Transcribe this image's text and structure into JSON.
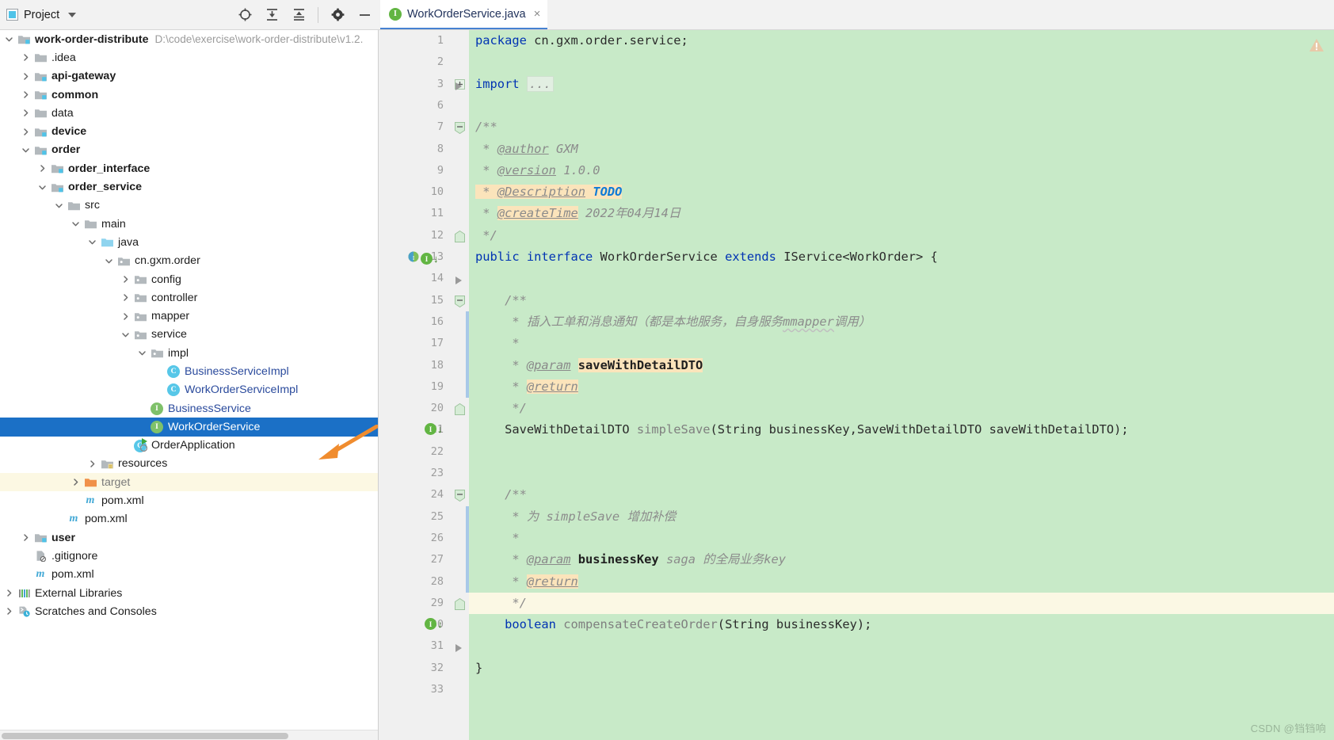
{
  "window": {
    "project_panel_title": "Project",
    "editor_tab": {
      "label": "WorkOrderService.java",
      "badge": "I",
      "close": "×"
    },
    "toolbar_icons": [
      "locate-icon",
      "expand-all-icon",
      "collapse-all-icon",
      "gear-icon",
      "minimize-icon"
    ]
  },
  "tree": [
    {
      "depth": 0,
      "arrow": "down",
      "icon": "module-folder",
      "label": "work-order-distribute",
      "bold": true,
      "path": "D:\\code\\exercise\\work-order-distribute\\v1.2."
    },
    {
      "depth": 1,
      "arrow": "right",
      "icon": "folder",
      "label": ".idea",
      "bold": false
    },
    {
      "depth": 1,
      "arrow": "right",
      "icon": "module-folder",
      "label": "api-gateway",
      "bold": true
    },
    {
      "depth": 1,
      "arrow": "right",
      "icon": "module-folder",
      "label": "common",
      "bold": true
    },
    {
      "depth": 1,
      "arrow": "right",
      "icon": "folder",
      "label": "data",
      "bold": false
    },
    {
      "depth": 1,
      "arrow": "right",
      "icon": "module-folder",
      "label": "device",
      "bold": true
    },
    {
      "depth": 1,
      "arrow": "down",
      "icon": "module-folder",
      "label": "order",
      "bold": true
    },
    {
      "depth": 2,
      "arrow": "right",
      "icon": "module-folder",
      "label": "order_interface",
      "bold": true
    },
    {
      "depth": 2,
      "arrow": "down",
      "icon": "module-folder",
      "label": "order_service",
      "bold": true
    },
    {
      "depth": 3,
      "arrow": "down",
      "icon": "folder",
      "label": "src",
      "bold": false
    },
    {
      "depth": 4,
      "arrow": "down",
      "icon": "folder",
      "label": "main",
      "bold": false
    },
    {
      "depth": 5,
      "arrow": "down",
      "icon": "source-folder",
      "label": "java",
      "bold": false
    },
    {
      "depth": 6,
      "arrow": "down",
      "icon": "package",
      "label": "cn.gxm.order",
      "bold": false
    },
    {
      "depth": 7,
      "arrow": "right",
      "icon": "package",
      "label": "config",
      "bold": false
    },
    {
      "depth": 7,
      "arrow": "right",
      "icon": "package",
      "label": "controller",
      "bold": false
    },
    {
      "depth": 7,
      "arrow": "right",
      "icon": "package",
      "label": "mapper",
      "bold": false
    },
    {
      "depth": 7,
      "arrow": "down",
      "icon": "package",
      "label": "service",
      "bold": false
    },
    {
      "depth": 8,
      "arrow": "down",
      "icon": "package",
      "label": "impl",
      "bold": false
    },
    {
      "depth": 9,
      "arrow": "none",
      "icon": "class",
      "label": "BusinessServiceImpl",
      "bold": false,
      "link": true
    },
    {
      "depth": 9,
      "arrow": "none",
      "icon": "class",
      "label": "WorkOrderServiceImpl",
      "bold": false,
      "link": true
    },
    {
      "depth": 8,
      "arrow": "none",
      "icon": "interface",
      "label": "BusinessService",
      "bold": false,
      "link": true
    },
    {
      "depth": 8,
      "arrow": "none",
      "icon": "interface",
      "label": "WorkOrderService",
      "bold": false,
      "link": true,
      "selected": true
    },
    {
      "depth": 7,
      "arrow": "none",
      "icon": "runnable-class",
      "label": "OrderApplication",
      "bold": false
    },
    {
      "depth": 5,
      "arrow": "right",
      "icon": "resources-folder",
      "label": "resources",
      "bold": false
    },
    {
      "depth": 4,
      "arrow": "right",
      "icon": "target-folder",
      "label": "target",
      "bold": false,
      "highlight": true,
      "muted": true
    },
    {
      "depth": 4,
      "arrow": "none",
      "icon": "maven",
      "label": "pom.xml",
      "bold": false
    },
    {
      "depth": 3,
      "arrow": "none",
      "icon": "maven",
      "label": "pom.xml",
      "bold": false
    },
    {
      "depth": 1,
      "arrow": "right",
      "icon": "module-folder",
      "label": "user",
      "bold": true
    },
    {
      "depth": 1,
      "arrow": "none",
      "icon": "gitignore",
      "label": ".gitignore",
      "bold": false
    },
    {
      "depth": 1,
      "arrow": "none",
      "icon": "maven",
      "label": "pom.xml",
      "bold": false
    },
    {
      "depth": 0,
      "arrow": "right",
      "icon": "external-libraries",
      "label": "External Libraries",
      "bold": false
    },
    {
      "depth": 0,
      "arrow": "right",
      "icon": "scratches",
      "label": "Scratches and Consoles",
      "bold": false
    }
  ],
  "code": {
    "line_numbers": [
      1,
      2,
      3,
      6,
      7,
      8,
      9,
      10,
      11,
      12,
      13,
      14,
      15,
      16,
      17,
      18,
      19,
      20,
      21,
      22,
      23,
      24,
      25,
      26,
      27,
      28,
      29,
      30,
      31,
      32,
      33
    ],
    "lines": [
      {
        "n": 1,
        "segments": [
          {
            "t": "package ",
            "c": "kw"
          },
          {
            "t": "cn.gxm.order.service;",
            "c": ""
          }
        ]
      },
      {
        "n": 2,
        "segments": []
      },
      {
        "n": 3,
        "segments": [
          {
            "t": "import ",
            "c": "kw"
          },
          {
            "t": "...",
            "c": "fold-placeholder"
          }
        ]
      },
      {
        "n": 6,
        "segments": []
      },
      {
        "n": 7,
        "segments": [
          {
            "t": "/**",
            "c": "cmt"
          }
        ]
      },
      {
        "n": 8,
        "segments": [
          {
            "t": " * ",
            "c": "cmt"
          },
          {
            "t": "@author",
            "c": "tag"
          },
          {
            "t": " GXM",
            "c": "cmt"
          }
        ]
      },
      {
        "n": 9,
        "segments": [
          {
            "t": " * ",
            "c": "cmt"
          },
          {
            "t": "@version",
            "c": "tag"
          },
          {
            "t": " 1.0.0",
            "c": "cmt"
          }
        ]
      },
      {
        "n": 10,
        "segments": [
          {
            "t": " * ",
            "c": "cmt-hl"
          },
          {
            "t": "@Description",
            "c": "tag-hl"
          },
          {
            "t": " ",
            "c": "cmt-hl"
          },
          {
            "t": "TODO",
            "c": "todo-hl"
          }
        ]
      },
      {
        "n": 11,
        "segments": [
          {
            "t": " * ",
            "c": "cmt"
          },
          {
            "t": "@createTime",
            "c": "tag-hl"
          },
          {
            "t": " 2022年04月14日",
            "c": "cmt"
          }
        ]
      },
      {
        "n": 12,
        "segments": [
          {
            "t": " */",
            "c": "cmt"
          }
        ]
      },
      {
        "n": 13,
        "segments": [
          {
            "t": "public ",
            "c": "kw"
          },
          {
            "t": "interface ",
            "c": "kw"
          },
          {
            "t": "WorkOrderService ",
            "c": ""
          },
          {
            "t": "extends ",
            "c": "kw"
          },
          {
            "t": "IService<WorkOrder> {",
            "c": ""
          }
        ]
      },
      {
        "n": 14,
        "segments": []
      },
      {
        "n": 15,
        "segments": [
          {
            "t": "    /**",
            "c": "cmt"
          }
        ]
      },
      {
        "n": 16,
        "segments": [
          {
            "t": "     * 插入工单和消息通知（都是本地服务，自身服务",
            "c": "cmt"
          },
          {
            "t": "mmapper",
            "c": "cmt-squiggle"
          },
          {
            "t": "调用）",
            "c": "cmt"
          }
        ]
      },
      {
        "n": 17,
        "segments": [
          {
            "t": "     *",
            "c": "cmt"
          }
        ]
      },
      {
        "n": 18,
        "segments": [
          {
            "t": "     * ",
            "c": "cmt"
          },
          {
            "t": "@param",
            "c": "tag"
          },
          {
            "t": " ",
            "c": "cmt"
          },
          {
            "t": "saveWithDetailDTO",
            "c": "param-hl"
          }
        ]
      },
      {
        "n": 19,
        "segments": [
          {
            "t": "     * ",
            "c": "cmt"
          },
          {
            "t": "@return",
            "c": "tag-hl"
          }
        ]
      },
      {
        "n": 20,
        "segments": [
          {
            "t": "     */",
            "c": "cmt"
          }
        ]
      },
      {
        "n": 21,
        "segments": [
          {
            "t": "    SaveWithDetailDTO ",
            "c": ""
          },
          {
            "t": "simpleSave",
            "c": "mname"
          },
          {
            "t": "(String businessKey,SaveWithDetailDTO saveWithDetailDTO);",
            "c": ""
          }
        ]
      },
      {
        "n": 22,
        "segments": []
      },
      {
        "n": 23,
        "segments": []
      },
      {
        "n": 24,
        "segments": [
          {
            "t": "    /**",
            "c": "cmt"
          }
        ]
      },
      {
        "n": 25,
        "segments": [
          {
            "t": "     * 为 simpleSave 增加补偿",
            "c": "cmt"
          }
        ]
      },
      {
        "n": 26,
        "segments": [
          {
            "t": "     *",
            "c": "cmt"
          }
        ]
      },
      {
        "n": 27,
        "segments": [
          {
            "t": "     * ",
            "c": "cmt"
          },
          {
            "t": "@param",
            "c": "tag"
          },
          {
            "t": " ",
            "c": "cmt"
          },
          {
            "t": "businessKey",
            "c": "param-b"
          },
          {
            "t": " saga 的全局业务key",
            "c": "cmt"
          }
        ]
      },
      {
        "n": 28,
        "segments": [
          {
            "t": "     * ",
            "c": "cmt"
          },
          {
            "t": "@return",
            "c": "tag-hl"
          }
        ]
      },
      {
        "n": 29,
        "segments": [
          {
            "t": "     */",
            "c": "cmt"
          },
          {
            "t": "",
            "c": "caret"
          }
        ]
      },
      {
        "n": 30,
        "segments": [
          {
            "t": "    boolean ",
            "c": "kw"
          },
          {
            "t": "compensateCreateOrder",
            "c": "mname"
          },
          {
            "t": "(String businessKey);",
            "c": ""
          }
        ]
      },
      {
        "n": 31,
        "segments": []
      },
      {
        "n": 32,
        "segments": [
          {
            "t": "}",
            "c": ""
          }
        ]
      },
      {
        "n": 33,
        "segments": []
      }
    ]
  },
  "gutter_markers": [
    {
      "line": 13,
      "icons": [
        "implemented-icon",
        "interface-impl-icon"
      ]
    },
    {
      "line": 21,
      "icons": [
        "interface-impl-icon"
      ]
    },
    {
      "line": 30,
      "icons": [
        "interface-impl-icon"
      ]
    }
  ],
  "overlay": {
    "annotation_arrow": "orange-arrow-pointer",
    "warning_icon": "warning-triangle-icon",
    "watermark": "CSDN @铛铛响"
  },
  "colors": {
    "editor_background": "#c8eac8",
    "selection": "#1b70c6",
    "caret_line": "#fbf8e4",
    "keyword": "#0033b3",
    "comment": "#8c8c8c",
    "tag_highlight": "#fbe4bb",
    "annotation_arrow": "#f08c2e",
    "interface_badge": "#62b543",
    "class_badge": "#57c7e8"
  }
}
